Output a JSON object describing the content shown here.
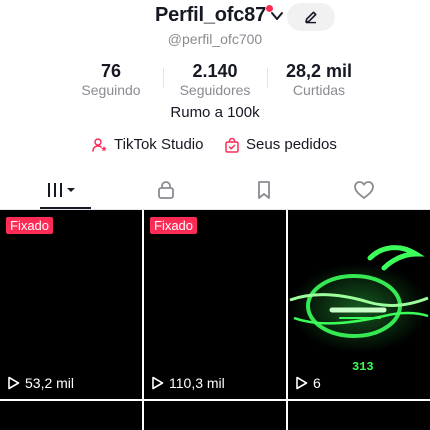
{
  "header": {
    "username": "Perfil_ofc87",
    "handle": "@perfil_ofc700"
  },
  "stats": [
    {
      "value": "76",
      "label": "Seguindo"
    },
    {
      "value": "2.140",
      "label": "Seguidores"
    },
    {
      "value": "28,2 mil",
      "label": "Curtidas"
    }
  ],
  "bio": "Rumo a 100k",
  "links": {
    "studio": "TikTok Studio",
    "orders": "Seus pedidos"
  },
  "tabs": [
    {
      "icon": "grid-icon",
      "active": true
    },
    {
      "icon": "lock-icon",
      "active": false
    },
    {
      "icon": "bookmark-icon",
      "active": false
    },
    {
      "icon": "heart-icon",
      "active": false
    }
  ],
  "videos": [
    {
      "pinned_label": "Fixado",
      "views": "53,2 mil"
    },
    {
      "pinned_label": "Fixado",
      "views": "110,3 mil"
    },
    {
      "views": "6",
      "overlay_text": "313"
    }
  ],
  "colors": {
    "accent": "#fe2c55",
    "text": "#161823",
    "muted": "#8a8b91",
    "neon": "#3cff5a"
  }
}
